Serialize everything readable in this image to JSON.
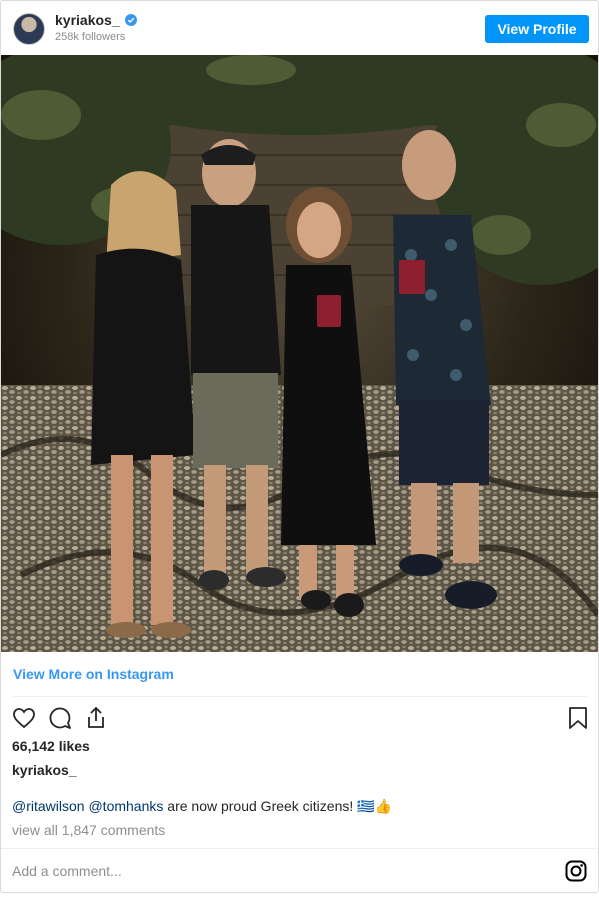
{
  "header": {
    "username": "kyriakos_",
    "followers": "258k followers",
    "view_profile_label": "View Profile"
  },
  "post": {
    "image_alt": "Four people standing on a pebble mosaic courtyard at night, two holding red passports",
    "view_more_label": "View More on Instagram",
    "likes": "66,142 likes",
    "owner": "kyriakos_",
    "caption": {
      "mention_1": "@ritawilson",
      "mention_2": "@tomhanks",
      "text": " are now proud Greek citizens! 🇬🇷👍"
    },
    "view_comments": "view all 1,847 comments",
    "add_comment_placeholder": "Add a comment..."
  },
  "icons": {
    "like": "heart-icon",
    "comment": "comment-icon",
    "share": "share-icon",
    "save": "bookmark-icon",
    "brand": "instagram-icon"
  },
  "colors": {
    "accent": "#0095f6",
    "link": "#3897f0",
    "mention": "#00376b",
    "muted": "#8e8e8e",
    "verified": "#3897f0"
  }
}
